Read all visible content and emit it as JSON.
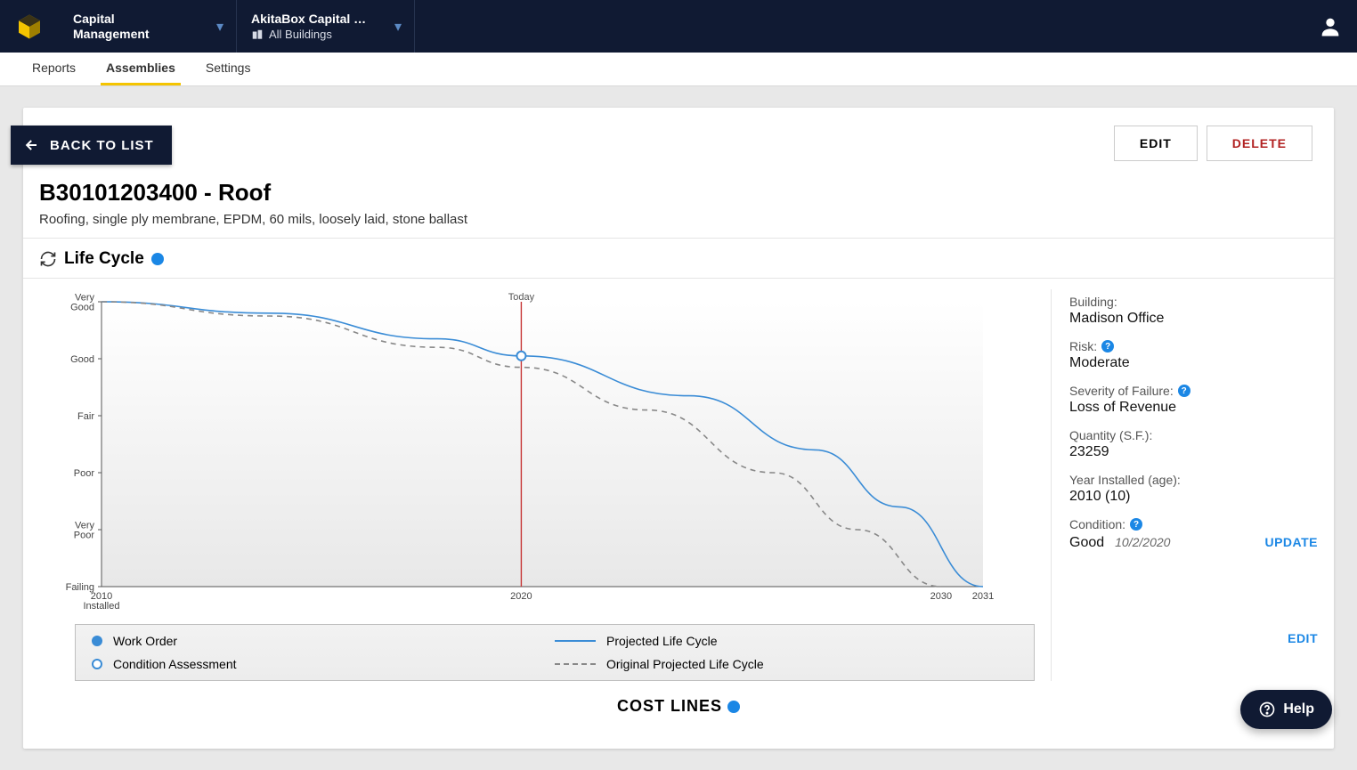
{
  "header": {
    "module_label": "Capital\nManagement",
    "app_label": "AkitaBox Capital …",
    "app_subline": "All Buildings"
  },
  "tabs": [
    "Reports",
    "Assemblies",
    "Settings"
  ],
  "active_tab": 1,
  "back_label": "BACK TO LIST",
  "actions": {
    "edit": "EDIT",
    "delete": "DELETE"
  },
  "assembly": {
    "title": "B30101203400 - Roof",
    "description": "Roofing, single ply membrane, EPDM, 60 mils, loosely laid, stone ballast"
  },
  "life_cycle": {
    "header": "Life Cycle",
    "today_label": "Today",
    "y_ticks": [
      "Very\nGood",
      "Good",
      "Fair",
      "Poor",
      "Very\nPoor",
      "Failing"
    ],
    "x_ticks": [
      "2010\nInstalled",
      "2020",
      "2030",
      "2031"
    ],
    "legend": {
      "work_order": "Work Order",
      "condition_assessment": "Condition Assessment",
      "projected": "Projected Life Cycle",
      "original": "Original Projected Life Cycle"
    }
  },
  "side": {
    "building_label": "Building:",
    "building_value": "Madison Office",
    "risk_label": "Risk:",
    "risk_value": "Moderate",
    "severity_label": "Severity of Failure:",
    "severity_value": "Loss of Revenue",
    "quantity_label": "Quantity (S.F.):",
    "quantity_value": "23259",
    "year_label": "Year Installed (age):",
    "year_value": "2010 (10)",
    "condition_label": "Condition:",
    "condition_value": "Good",
    "condition_date": "10/2/2020",
    "update": "UPDATE",
    "edit": "EDIT"
  },
  "cost_lines_label": "COST LINES",
  "help_label": "Help",
  "chart_data": {
    "type": "line",
    "xlabel": "",
    "ylabel": "",
    "x_domain_years": [
      2010,
      2031
    ],
    "y_categories": [
      "Very Good",
      "Good",
      "Fair",
      "Poor",
      "Very Poor",
      "Failing"
    ],
    "y_numeric_map": {
      "Very Good": 5,
      "Good": 4,
      "Fair": 3,
      "Poor": 2,
      "Very Poor": 1,
      "Failing": 0
    },
    "today_year": 2020,
    "series": [
      {
        "name": "Projected Life Cycle",
        "style": "solid",
        "color": "#3a8cd6",
        "points": [
          {
            "x": 2010,
            "y": 5.0
          },
          {
            "x": 2014,
            "y": 4.8
          },
          {
            "x": 2018,
            "y": 4.35
          },
          {
            "x": 2020,
            "y": 4.05
          },
          {
            "x": 2024,
            "y": 3.35
          },
          {
            "x": 2027,
            "y": 2.4
          },
          {
            "x": 2029,
            "y": 1.4
          },
          {
            "x": 2031,
            "y": 0.0
          }
        ]
      },
      {
        "name": "Original Projected Life Cycle",
        "style": "dashed",
        "color": "#888888",
        "points": [
          {
            "x": 2010,
            "y": 5.0
          },
          {
            "x": 2014,
            "y": 4.75
          },
          {
            "x": 2018,
            "y": 4.2
          },
          {
            "x": 2020,
            "y": 3.85
          },
          {
            "x": 2023,
            "y": 3.1
          },
          {
            "x": 2026,
            "y": 2.0
          },
          {
            "x": 2028,
            "y": 1.0
          },
          {
            "x": 2030,
            "y": 0.0
          }
        ]
      }
    ],
    "markers": [
      {
        "kind": "Condition Assessment",
        "x": 2020,
        "y": 4.05
      }
    ]
  }
}
